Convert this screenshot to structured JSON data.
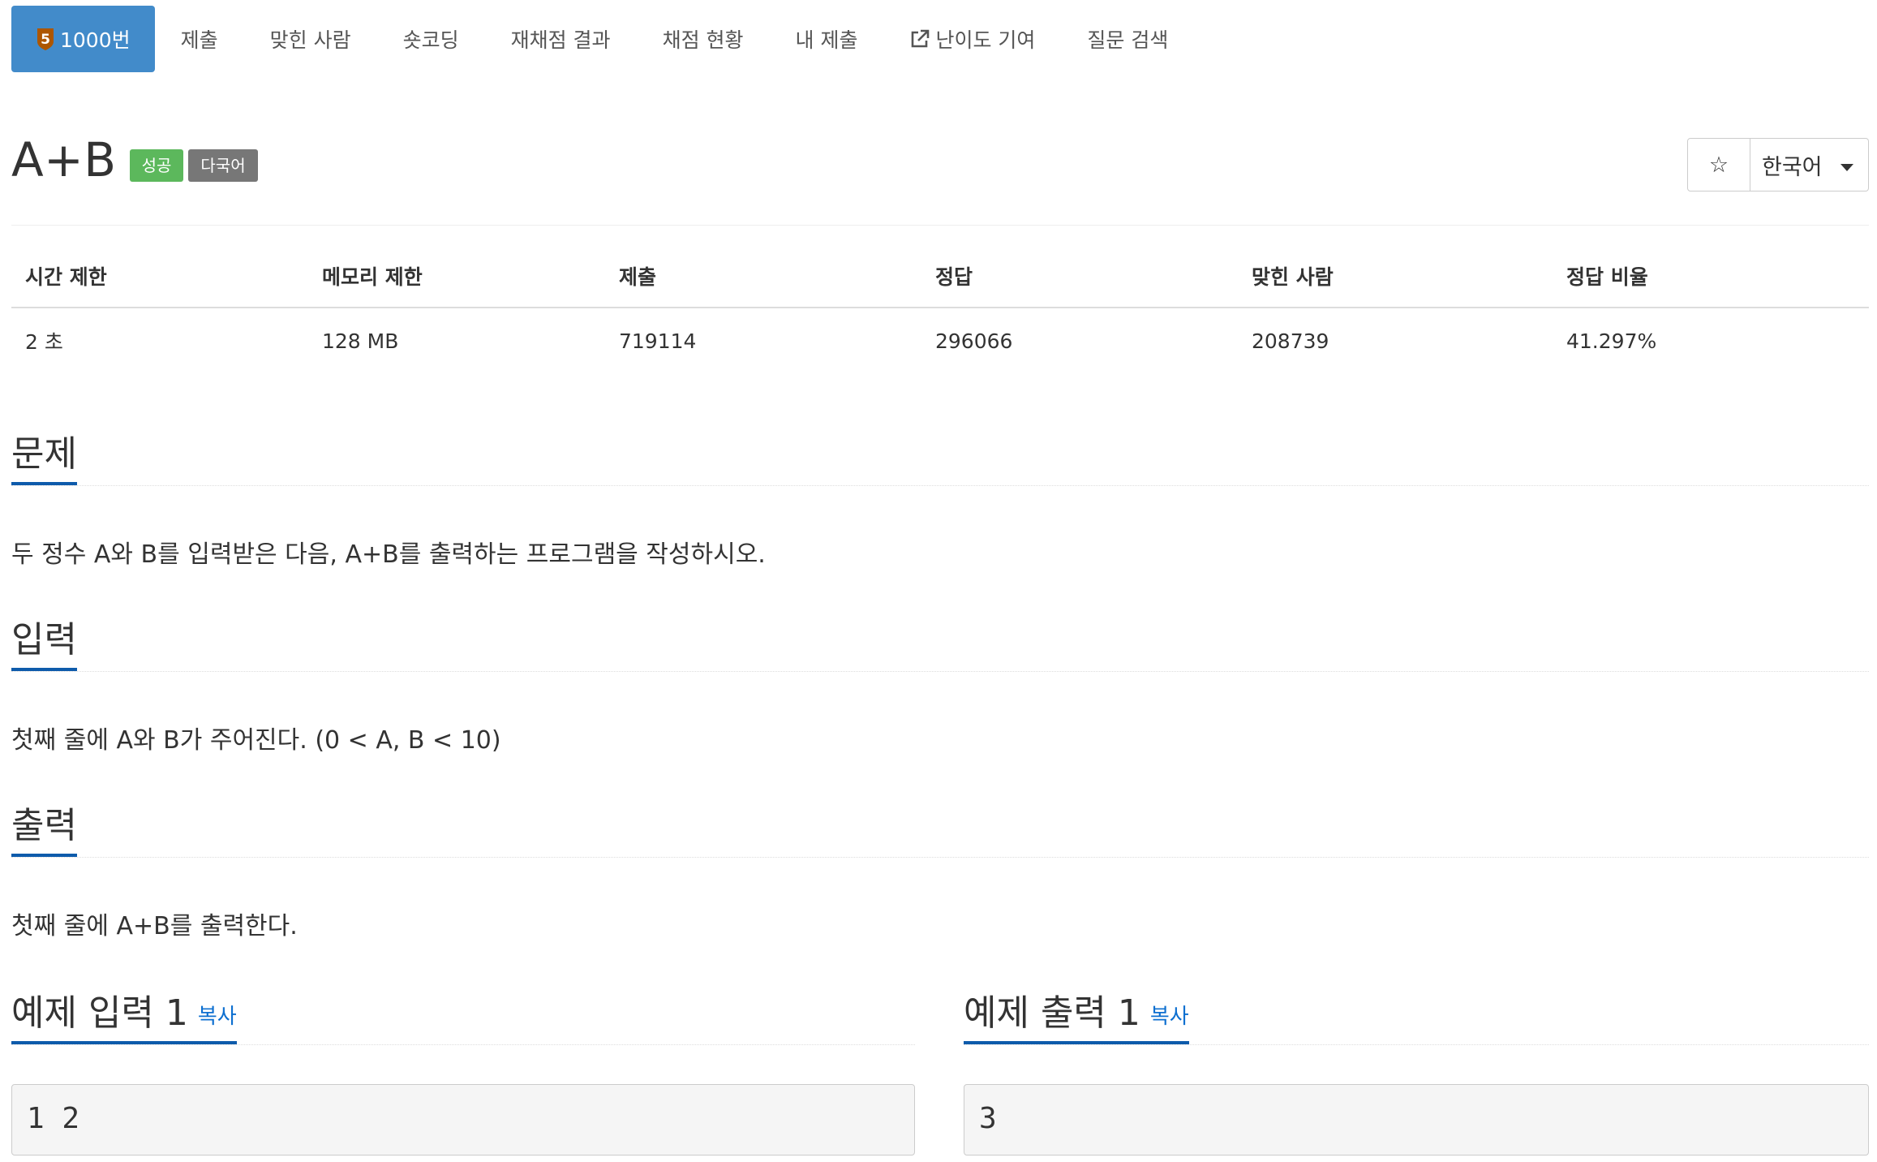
{
  "nav": {
    "tabs": [
      {
        "label": "1000번",
        "badge": "5",
        "active": true
      },
      {
        "label": "제출"
      },
      {
        "label": "맞힌 사람"
      },
      {
        "label": "숏코딩"
      },
      {
        "label": "재채점 결과"
      },
      {
        "label": "채점 현황"
      },
      {
        "label": "내 제출"
      },
      {
        "label": "난이도 기여",
        "icon": "external-link-icon"
      },
      {
        "label": "질문 검색"
      }
    ]
  },
  "problem": {
    "title": "A+B",
    "labels": [
      "성공",
      "다국어"
    ],
    "star_icon": "☆",
    "language": "한국어"
  },
  "info_table": {
    "headers": [
      "시간 제한",
      "메모리 제한",
      "제출",
      "정답",
      "맞힌 사람",
      "정답 비율"
    ],
    "row": [
      "2 초",
      "128 MB",
      "719114",
      "296066",
      "208739",
      "41.297%"
    ]
  },
  "sections": {
    "problem": {
      "heading": "문제",
      "text": "두 정수 A와 B를 입력받은 다음, A+B를 출력하는 프로그램을 작성하시오."
    },
    "input": {
      "heading": "입력",
      "text": "첫째 줄에 A와 B가 주어진다. (0 < A, B < 10)"
    },
    "output": {
      "heading": "출력",
      "text": "첫째 줄에 A+B를 출력한다."
    }
  },
  "samples": {
    "input": {
      "heading": "예제 입력 1",
      "copy_label": "복사",
      "value": "1 2"
    },
    "output": {
      "heading": "예제 출력 1",
      "copy_label": "복사",
      "value": "3"
    }
  },
  "colors": {
    "nav_active_bg": "#428bca",
    "label_success": "#5cb85c",
    "label_default": "#777777",
    "section_underline": "#0e5bab",
    "link": "#0d6fd0",
    "tier_badge": "#ad5600"
  }
}
